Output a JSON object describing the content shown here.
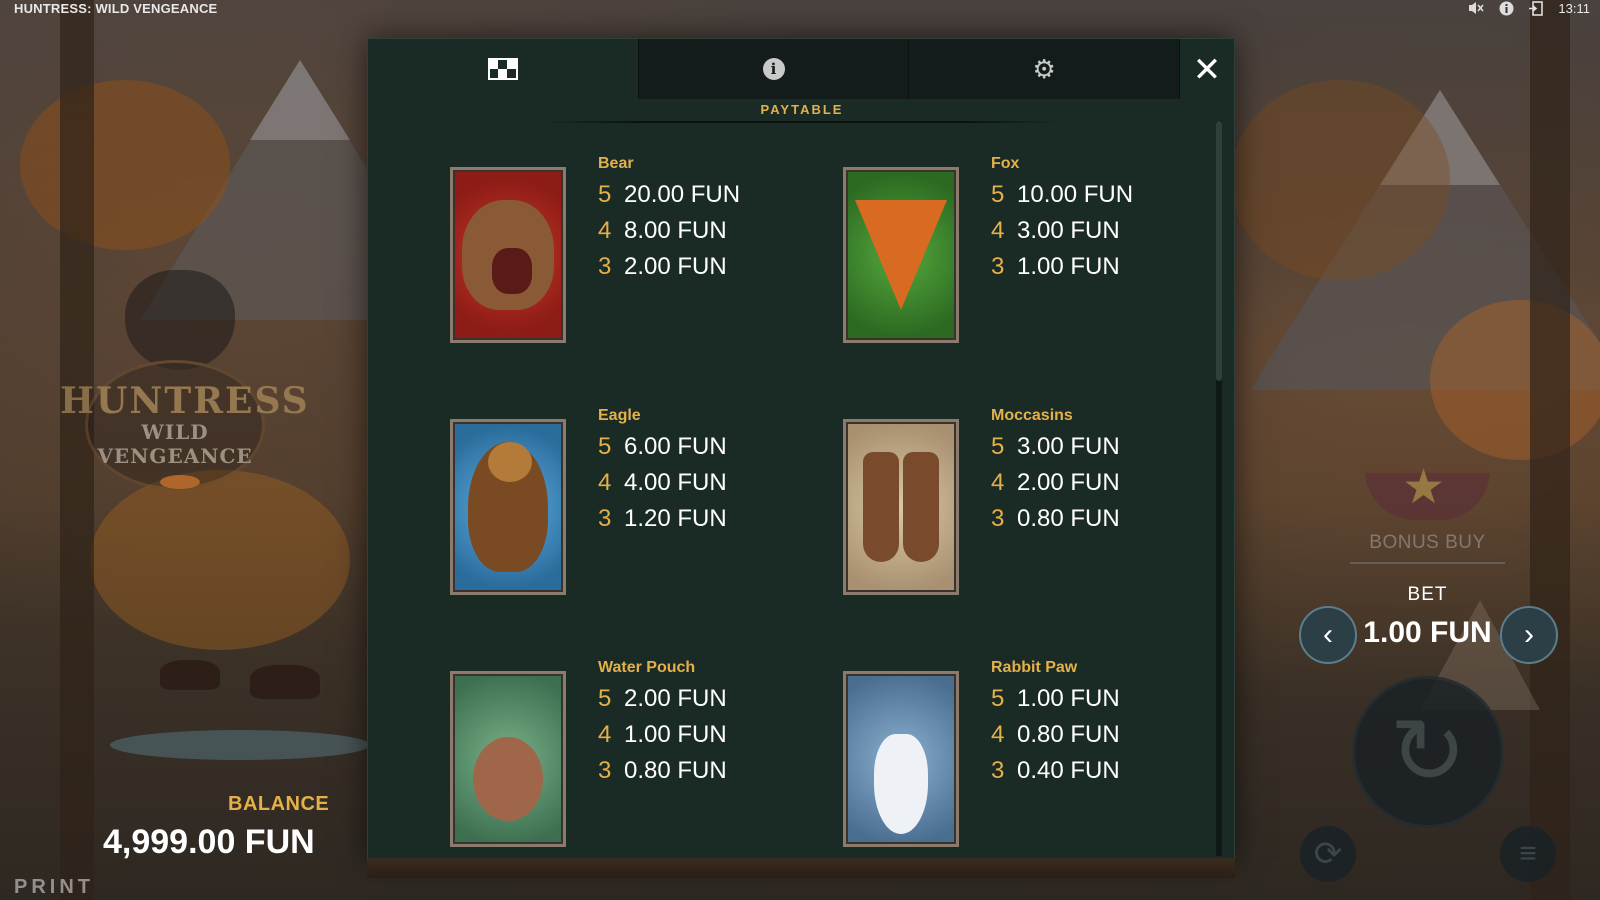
{
  "window": {
    "title": "HUNTRESS: WILD VENGEANCE",
    "clock": "13:11",
    "icons": [
      "mute-icon",
      "info-icon",
      "exit-icon"
    ]
  },
  "logo": {
    "line1": "HUNTRESS",
    "line2": "WILD VENGEANCE"
  },
  "balance": {
    "label": "BALANCE",
    "value": "4,999.00 FUN"
  },
  "brand": "PRINT",
  "controls": {
    "bonus_buy_label": "BONUS BUY",
    "bet_label": "BET",
    "bet_value": "1.00 FUN",
    "bet_prev_glyph": "‹",
    "bet_next_glyph": "›",
    "spin_glyph": "↻",
    "autoplay_glyph": "⟳",
    "menu_glyph": "≡"
  },
  "modal": {
    "tabs": [
      {
        "name": "paytable",
        "icon": "paytable-grid-icon",
        "active": true
      },
      {
        "name": "info",
        "icon": "info-icon",
        "glyph": "i",
        "active": false
      },
      {
        "name": "settings",
        "icon": "gear-icon",
        "glyph": "⚙",
        "active": false
      }
    ],
    "close_glyph": "✕",
    "section_title": "PAYTABLE",
    "symbols": [
      {
        "name": "Bear",
        "icon": "bear-icon",
        "pays": [
          {
            "count": "5",
            "amount": "20.00 FUN"
          },
          {
            "count": "4",
            "amount": "8.00 FUN"
          },
          {
            "count": "3",
            "amount": "2.00 FUN"
          }
        ]
      },
      {
        "name": "Fox",
        "icon": "fox-icon",
        "pays": [
          {
            "count": "5",
            "amount": "10.00 FUN"
          },
          {
            "count": "4",
            "amount": "3.00 FUN"
          },
          {
            "count": "3",
            "amount": "1.00 FUN"
          }
        ]
      },
      {
        "name": "Eagle",
        "icon": "eagle-icon",
        "pays": [
          {
            "count": "5",
            "amount": "6.00 FUN"
          },
          {
            "count": "4",
            "amount": "4.00 FUN"
          },
          {
            "count": "3",
            "amount": "1.20 FUN"
          }
        ]
      },
      {
        "name": "Moccasins",
        "icon": "moccasins-icon",
        "pays": [
          {
            "count": "5",
            "amount": "3.00 FUN"
          },
          {
            "count": "4",
            "amount": "2.00 FUN"
          },
          {
            "count": "3",
            "amount": "0.80 FUN"
          }
        ]
      },
      {
        "name": "Water Pouch",
        "icon": "water-pouch-icon",
        "pays": [
          {
            "count": "5",
            "amount": "2.00 FUN"
          },
          {
            "count": "4",
            "amount": "1.00 FUN"
          },
          {
            "count": "3",
            "amount": "0.80 FUN"
          }
        ]
      },
      {
        "name": "Rabbit Paw",
        "icon": "rabbit-paw-icon",
        "pays": [
          {
            "count": "5",
            "amount": "1.00 FUN"
          },
          {
            "count": "4",
            "amount": "0.80 FUN"
          },
          {
            "count": "3",
            "amount": "0.40 FUN"
          }
        ]
      }
    ]
  },
  "colors": {
    "accent_gold": "#e4b04a",
    "modal_bg": "#1a2b26",
    "tab_inactive": "#131c1a"
  }
}
